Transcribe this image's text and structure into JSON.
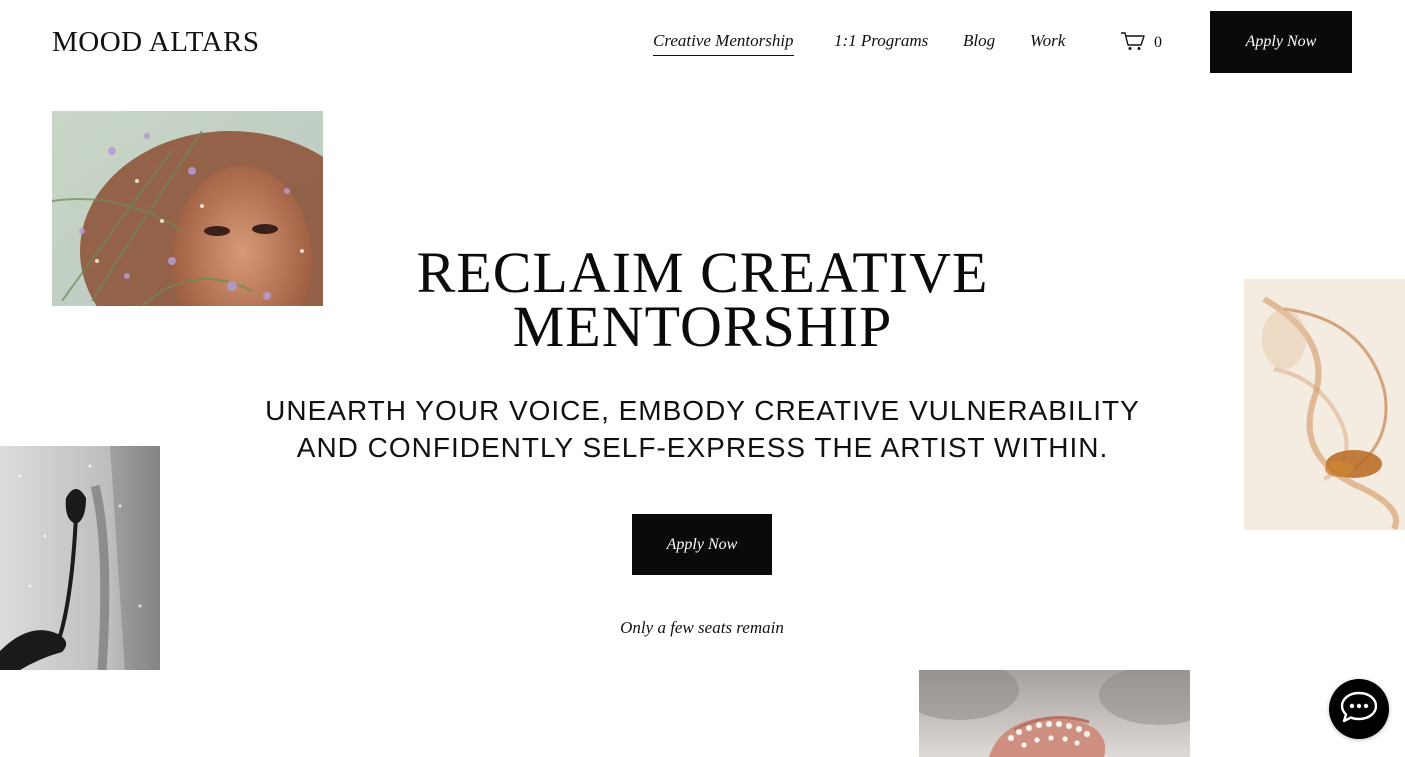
{
  "brand": {
    "logo_text": "MOOD ALTARS"
  },
  "nav": {
    "items": [
      {
        "label": "Creative Mentorship",
        "active": true
      },
      {
        "label": "1:1 Programs",
        "active": false
      },
      {
        "label": "Blog",
        "active": false
      },
      {
        "label": "Work",
        "active": false
      }
    ],
    "cart_count": "0",
    "cart_icon": "cart-icon",
    "apply_label": "Apply Now"
  },
  "hero": {
    "title_line1": "RECLAIM CREATIVE",
    "title_line2": "MENTORSHIP",
    "subtitle_line1": "UNEARTH YOUR VOICE, EMBODY CREATIVE VULNERABILITY",
    "subtitle_line2": "AND CONFIDENTLY SELF-EXPRESS THE ARTIST WITHIN.",
    "cta_label": "Apply Now",
    "note": "Only a few seats remain"
  },
  "colors": {
    "button_bg": "#0a0a0a",
    "text": "#111111",
    "background": "#ffffff"
  },
  "chat": {
    "icon": "chat-bubble-icon"
  }
}
